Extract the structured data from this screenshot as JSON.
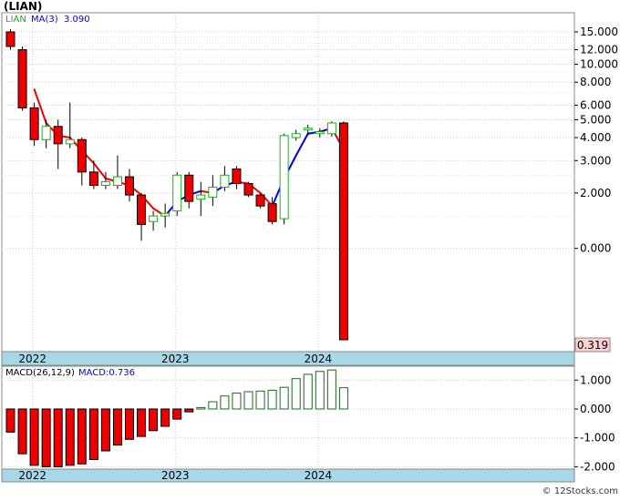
{
  "title": "(LIAN)",
  "legend": {
    "ticker": "LIAN",
    "ma_label": "MA(3)",
    "ma_value": "3.090"
  },
  "macd_legend": {
    "params": "MACD(26,12,9)",
    "value_label": "MACD:0.736"
  },
  "last_price_label": "0.319",
  "watermark": "© 12Stocks.com",
  "colors": {
    "up_candle": "#22aa22",
    "down_candle": "#ee0000",
    "ma_up": "#0000ee",
    "ma_down": "#ee0000",
    "axis_band": "#a8d8e8",
    "price_label_bg": "#ffd0d0",
    "grid": "#cccccc"
  },
  "chart_data": [
    {
      "type": "candlestick",
      "price_axis": {
        "scale": "log",
        "ticks": [
          "15.000",
          "12.000",
          "10.000",
          "8.000",
          "6.000",
          "5.000",
          "4.000",
          "3.000",
          "2.000",
          "0.000"
        ]
      },
      "x_axis": {
        "labels": [
          "2022",
          "2023",
          "2024"
        ]
      },
      "candles": [
        {
          "o": 15.0,
          "h": 15.5,
          "l": 12.0,
          "c": 12.5
        },
        {
          "o": 12.0,
          "h": 12.5,
          "l": 5.6,
          "c": 5.8
        },
        {
          "o": 5.8,
          "h": 6.2,
          "l": 3.6,
          "c": 3.9
        },
        {
          "o": 3.9,
          "h": 5.0,
          "l": 3.5,
          "c": 4.6
        },
        {
          "o": 4.6,
          "h": 5.0,
          "l": 2.7,
          "c": 3.7
        },
        {
          "o": 3.7,
          "h": 6.2,
          "l": 3.5,
          "c": 3.9
        },
        {
          "o": 3.9,
          "h": 4.0,
          "l": 2.2,
          "c": 2.6
        },
        {
          "o": 2.6,
          "h": 3.0,
          "l": 2.1,
          "c": 2.2
        },
        {
          "o": 2.2,
          "h": 2.6,
          "l": 2.1,
          "c": 2.3
        },
        {
          "o": 2.2,
          "h": 3.2,
          "l": 2.1,
          "c": 2.45
        },
        {
          "o": 2.45,
          "h": 2.7,
          "l": 1.8,
          "c": 1.95
        },
        {
          "o": 1.95,
          "h": 2.0,
          "l": 1.1,
          "c": 1.35
        },
        {
          "o": 1.4,
          "h": 1.6,
          "l": 1.25,
          "c": 1.5
        },
        {
          "o": 1.5,
          "h": 1.75,
          "l": 1.3,
          "c": 1.55
        },
        {
          "o": 1.6,
          "h": 2.6,
          "l": 1.5,
          "c": 2.5
        },
        {
          "o": 2.5,
          "h": 2.6,
          "l": 1.65,
          "c": 1.8
        },
        {
          "o": 1.85,
          "h": 2.3,
          "l": 1.5,
          "c": 1.95
        },
        {
          "o": 1.9,
          "h": 2.5,
          "l": 1.7,
          "c": 2.15
        },
        {
          "o": 2.15,
          "h": 2.8,
          "l": 2.05,
          "c": 2.5
        },
        {
          "o": 2.7,
          "h": 2.8,
          "l": 2.1,
          "c": 2.25
        },
        {
          "o": 2.25,
          "h": 2.3,
          "l": 1.9,
          "c": 1.95
        },
        {
          "o": 1.95,
          "h": 2.0,
          "l": 1.65,
          "c": 1.7
        },
        {
          "o": 1.75,
          "h": 1.9,
          "l": 1.35,
          "c": 1.4
        },
        {
          "o": 1.45,
          "h": 4.2,
          "l": 1.35,
          "c": 4.1
        },
        {
          "o": 4.0,
          "h": 4.4,
          "l": 3.85,
          "c": 4.2
        },
        {
          "o": 4.4,
          "h": 4.7,
          "l": 4.1,
          "c": 4.5
        },
        {
          "o": 4.2,
          "h": 4.5,
          "l": 4.0,
          "c": 4.3
        },
        {
          "o": 4.2,
          "h": 4.9,
          "l": 4.05,
          "c": 4.8
        },
        {
          "o": 4.8,
          "h": 4.9,
          "l": 0.319,
          "c": 0.319
        }
      ],
      "moving_average": {
        "name": "MA(3)",
        "values": [
          null,
          null,
          7.3,
          4.8,
          4.1,
          4.0,
          3.4,
          2.9,
          2.4,
          2.3,
          2.2,
          1.95,
          1.65,
          1.5,
          1.8,
          1.95,
          2.05,
          2.0,
          2.2,
          2.3,
          2.25,
          2.0,
          1.7,
          2.4,
          3.2,
          4.2,
          4.3,
          4.5,
          3.45
        ]
      },
      "last_value": 0.319
    },
    {
      "type": "histogram",
      "name": "MACD",
      "y_axis": {
        "ticks": [
          "1.000",
          "0.000",
          "-1.000",
          "-2.000"
        ],
        "ylim": [
          -2.05,
          1.45
        ]
      },
      "x_axis": {
        "labels": [
          "2022",
          "2023",
          "2024"
        ]
      },
      "values": [
        -0.8,
        -1.55,
        -1.95,
        -2.0,
        -2.0,
        -1.95,
        -1.9,
        -1.75,
        -1.45,
        -1.25,
        -1.05,
        -0.95,
        -0.75,
        -0.6,
        -0.35,
        -0.1,
        0.05,
        0.25,
        0.45,
        0.55,
        0.6,
        0.62,
        0.65,
        0.75,
        1.05,
        1.2,
        1.3,
        1.35,
        0.736
      ]
    }
  ]
}
